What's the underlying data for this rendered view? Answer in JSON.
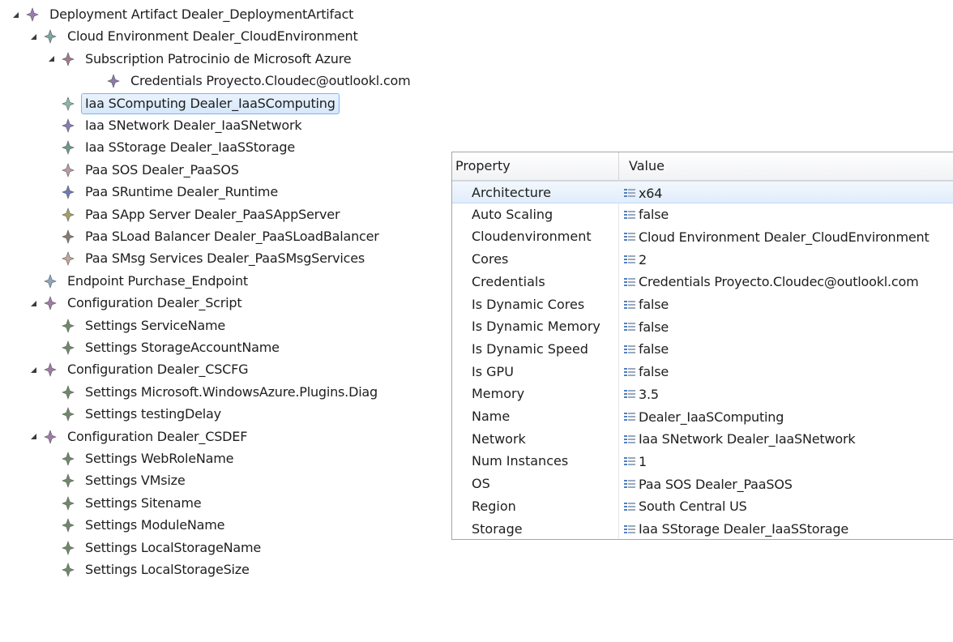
{
  "tree": [
    {
      "label": "Deployment Artifact Dealer_DeploymentArtifact",
      "depth": 0,
      "expanded": true,
      "selected": false,
      "color": "#9b7bb5"
    },
    {
      "label": "Cloud Environment Dealer_CloudEnvironment",
      "depth": 1,
      "expanded": true,
      "selected": false,
      "color": "#7aa7a0"
    },
    {
      "label": "Subscription Patrocinio de Microsoft Azure",
      "depth": 2,
      "expanded": true,
      "selected": false,
      "color": "#a07a8e"
    },
    {
      "label": "Credentials Proyecto.Cloudec@outlookl.com",
      "depth": 3,
      "expanded": null,
      "selected": false,
      "color": "#8f7aa8"
    },
    {
      "label": "Iaa SComputing Dealer_IaaSComputing",
      "depth": 2,
      "expanded": null,
      "selected": true,
      "color": "#8bb8a8"
    },
    {
      "label": "Iaa SNetwork Dealer_IaaSNetwork",
      "depth": 2,
      "expanded": null,
      "selected": false,
      "color": "#8a7ab8"
    },
    {
      "label": "Iaa SStorage Dealer_IaaSStorage",
      "depth": 2,
      "expanded": null,
      "selected": false,
      "color": "#6f9a86"
    },
    {
      "label": "Paa SOS Dealer_PaaSOS",
      "depth": 2,
      "expanded": null,
      "selected": false,
      "color": "#b89aaa"
    },
    {
      "label": "Paa SRuntime Dealer_Runtime",
      "depth": 2,
      "expanded": null,
      "selected": false,
      "color": "#6e7ab8"
    },
    {
      "label": "Paa SApp Server Dealer_PaaSAppServer",
      "depth": 2,
      "expanded": null,
      "selected": false,
      "color": "#a8a06a"
    },
    {
      "label": "Paa SLoad Balancer Dealer_PaaSLoadBalancer",
      "depth": 2,
      "expanded": null,
      "selected": false,
      "color": "#8a7a70"
    },
    {
      "label": "Paa SMsg Services Dealer_PaaSMsgServices",
      "depth": 2,
      "expanded": null,
      "selected": false,
      "color": "#c0a89a"
    },
    {
      "label": "Endpoint Purchase_Endpoint",
      "depth": 1,
      "expanded": null,
      "selected": false,
      "color": "#8aa8c0"
    },
    {
      "label": "Configuration Dealer_Script",
      "depth": 1,
      "expanded": true,
      "selected": false,
      "color": "#a07aa8"
    },
    {
      "label": "Settings ServiceName",
      "depth": 2,
      "expanded": null,
      "selected": false,
      "color": "#6f8a6a"
    },
    {
      "label": "Settings StorageAccountName",
      "depth": 2,
      "expanded": null,
      "selected": false,
      "color": "#6f8a6a"
    },
    {
      "label": "Configuration Dealer_CSCFG",
      "depth": 1,
      "expanded": true,
      "selected": false,
      "color": "#a07aa8"
    },
    {
      "label": "Settings Microsoft.WindowsAzure.Plugins.Diag",
      "depth": 2,
      "expanded": null,
      "selected": false,
      "color": "#6f8a6a"
    },
    {
      "label": "Settings testingDelay",
      "depth": 2,
      "expanded": null,
      "selected": false,
      "color": "#6f8a6a"
    },
    {
      "label": "Configuration Dealer_CSDEF",
      "depth": 1,
      "expanded": true,
      "selected": false,
      "color": "#a07aa8"
    },
    {
      "label": "Settings WebRoleName",
      "depth": 2,
      "expanded": null,
      "selected": false,
      "color": "#6f8a6a"
    },
    {
      "label": "Settings VMsize",
      "depth": 2,
      "expanded": null,
      "selected": false,
      "color": "#6f8a6a"
    },
    {
      "label": "Settings Sitename",
      "depth": 2,
      "expanded": null,
      "selected": false,
      "color": "#6f8a6a"
    },
    {
      "label": "Settings ModuleName",
      "depth": 2,
      "expanded": null,
      "selected": false,
      "color": "#6f8a6a"
    },
    {
      "label": "Settings LocalStorageName",
      "depth": 2,
      "expanded": null,
      "selected": false,
      "color": "#6f8a6a"
    },
    {
      "label": "Settings LocalStorageSize",
      "depth": 2,
      "expanded": null,
      "selected": false,
      "color": "#6f8a6a"
    }
  ],
  "properties": {
    "header": {
      "property": "Property",
      "value": "Value"
    },
    "selected_row": "Architecture",
    "rows": [
      {
        "name": "Architecture",
        "value": "x64"
      },
      {
        "name": "Auto Scaling",
        "value": "false"
      },
      {
        "name": "Cloudenvironment",
        "value": "Cloud Environment Dealer_CloudEnvironment"
      },
      {
        "name": "Cores",
        "value": "2"
      },
      {
        "name": "Credentials",
        "value": "Credentials Proyecto.Cloudec@outlookl.com"
      },
      {
        "name": "Is Dynamic Cores",
        "value": "false"
      },
      {
        "name": "Is Dynamic Memory",
        "value": "false"
      },
      {
        "name": "Is Dynamic Speed",
        "value": "false"
      },
      {
        "name": "Is GPU",
        "value": "false"
      },
      {
        "name": "Memory",
        "value": "3.5"
      },
      {
        "name": "Name",
        "value": "Dealer_IaaSComputing"
      },
      {
        "name": "Network",
        "value": "Iaa SNetwork Dealer_IaaSNetwork"
      },
      {
        "name": "Num Instances",
        "value": "1"
      },
      {
        "name": "OS",
        "value": "Paa SOS Dealer_PaaSOS"
      },
      {
        "name": "Region",
        "value": "South Central US"
      },
      {
        "name": "Storage",
        "value": "Iaa SStorage Dealer_IaaSStorage"
      }
    ]
  },
  "icons": {
    "node": "diamond-node-icon",
    "value": "property-value-icon",
    "expand": "expand-triangle-icon"
  }
}
